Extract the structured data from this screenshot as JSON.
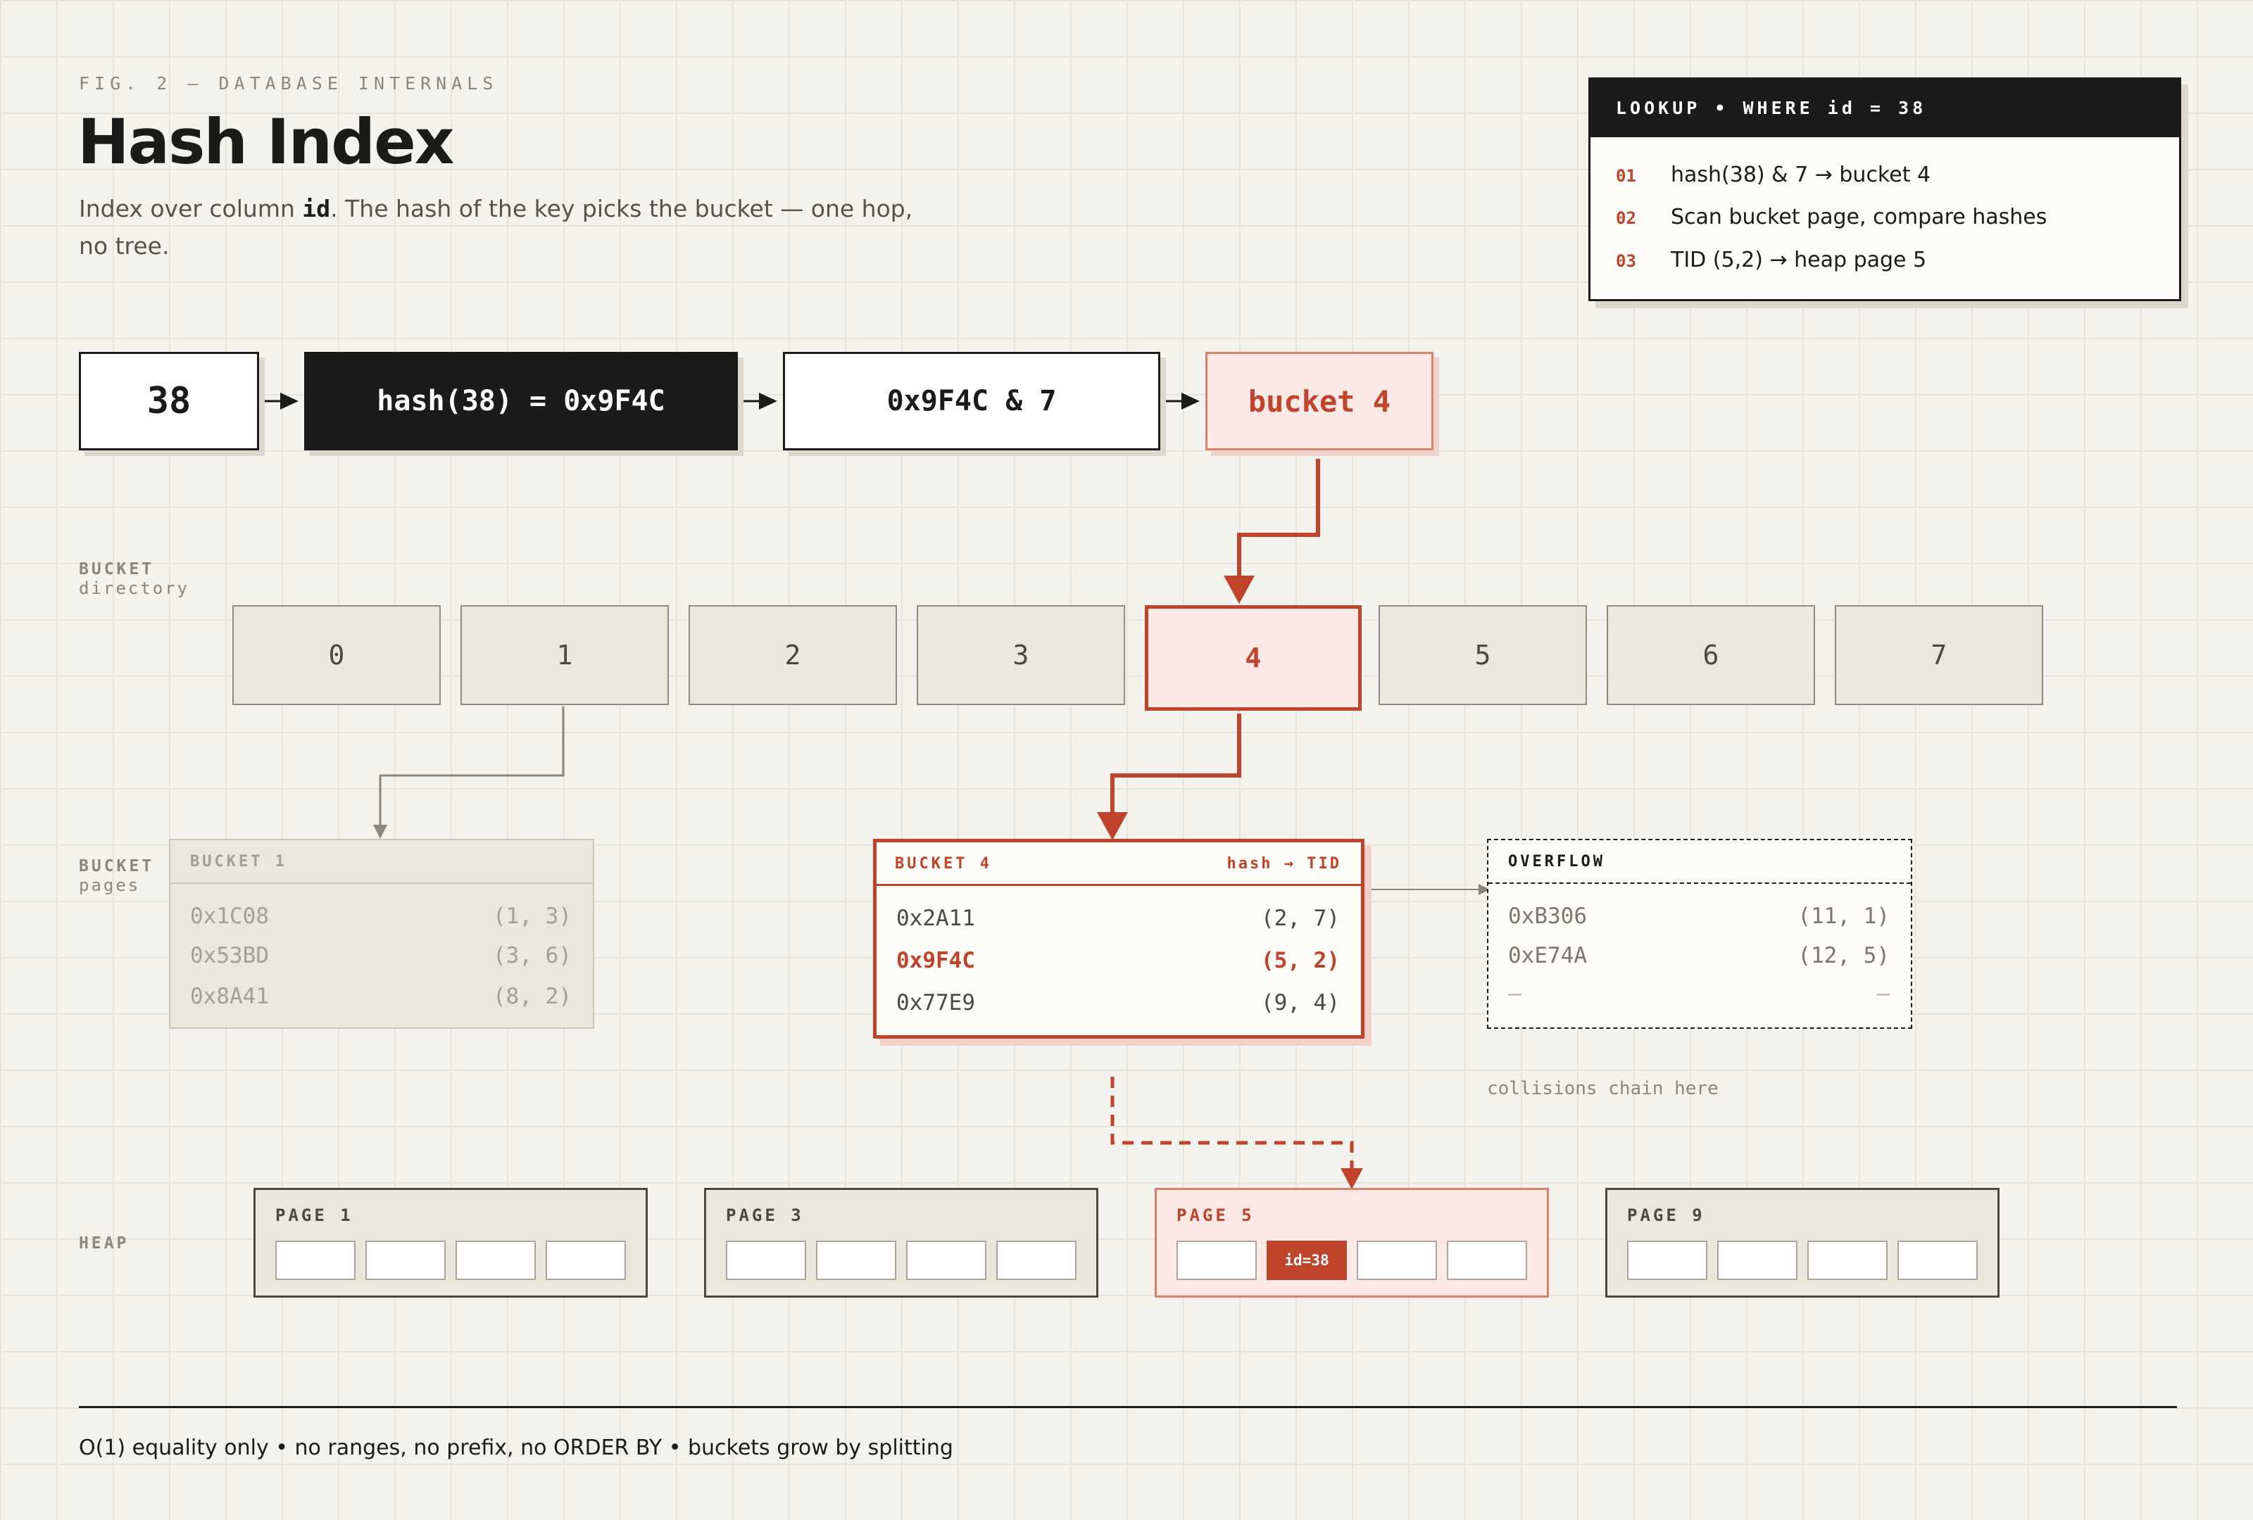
{
  "header": {
    "kicker": "FIG. 2 — DATABASE INTERNALS",
    "title": "Hash Index",
    "subtitle_pre": "Index over column ",
    "subtitle_key": "id",
    "subtitle_post": ". The hash of the key picks the bucket — one hop, no tree."
  },
  "lookup": {
    "title": "LOOKUP • WHERE id = 38",
    "steps": [
      {
        "num": "01",
        "text": "hash(38) & 7 → bucket 4"
      },
      {
        "num": "02",
        "text": "Scan bucket page, compare hashes"
      },
      {
        "num": "03",
        "text": "TID (5,2) → heap page 5"
      }
    ]
  },
  "flow": {
    "key": "38",
    "hash": "hash(38) = 0x9F4C",
    "mask": "0x9F4C & 7",
    "bucket": "bucket 4"
  },
  "labels": {
    "directory": [
      "BUCKET",
      "directory"
    ],
    "pages": [
      "BUCKET",
      "pages"
    ],
    "heap": "HEAP"
  },
  "directory": {
    "slots": [
      "0",
      "1",
      "2",
      "3",
      "4",
      "5",
      "6",
      "7"
    ],
    "active_index": 4
  },
  "bucket1": {
    "title": "BUCKET 1",
    "rows": [
      {
        "hash": "0x1C08",
        "tid": "(1, 3)"
      },
      {
        "hash": "0x53BD",
        "tid": "(3, 6)"
      },
      {
        "hash": "0x8A41",
        "tid": "(8, 2)"
      }
    ]
  },
  "bucket4": {
    "title": "BUCKET 4",
    "legend": "hash → TID",
    "rows": [
      {
        "hash": "0x2A11",
        "tid": "(2, 7)"
      },
      {
        "hash": "0x9F4C",
        "tid": "(5, 2)"
      },
      {
        "hash": "0x77E9",
        "tid": "(9, 4)"
      }
    ]
  },
  "overflow": {
    "title": "OVERFLOW",
    "rows": [
      {
        "hash": "0xB306",
        "tid": "(11, 1)"
      },
      {
        "hash": "0xE74A",
        "tid": "(12, 5)"
      },
      {
        "hash": "—",
        "tid": "—"
      }
    ],
    "note": "collisions chain here"
  },
  "heap": {
    "pages": [
      {
        "label": "PAGE 1"
      },
      {
        "label": "PAGE 3"
      },
      {
        "label": "PAGE 5",
        "hit": "id=38"
      },
      {
        "label": "PAGE 9"
      }
    ]
  },
  "footer": "O(1) equality only • no ranges, no prefix, no ORDER BY • buckets grow by splitting",
  "colors": {
    "accent": "#c0432c",
    "ink": "#1b1b19",
    "paper": "#f4f2ec",
    "muted": "#8a877d"
  }
}
